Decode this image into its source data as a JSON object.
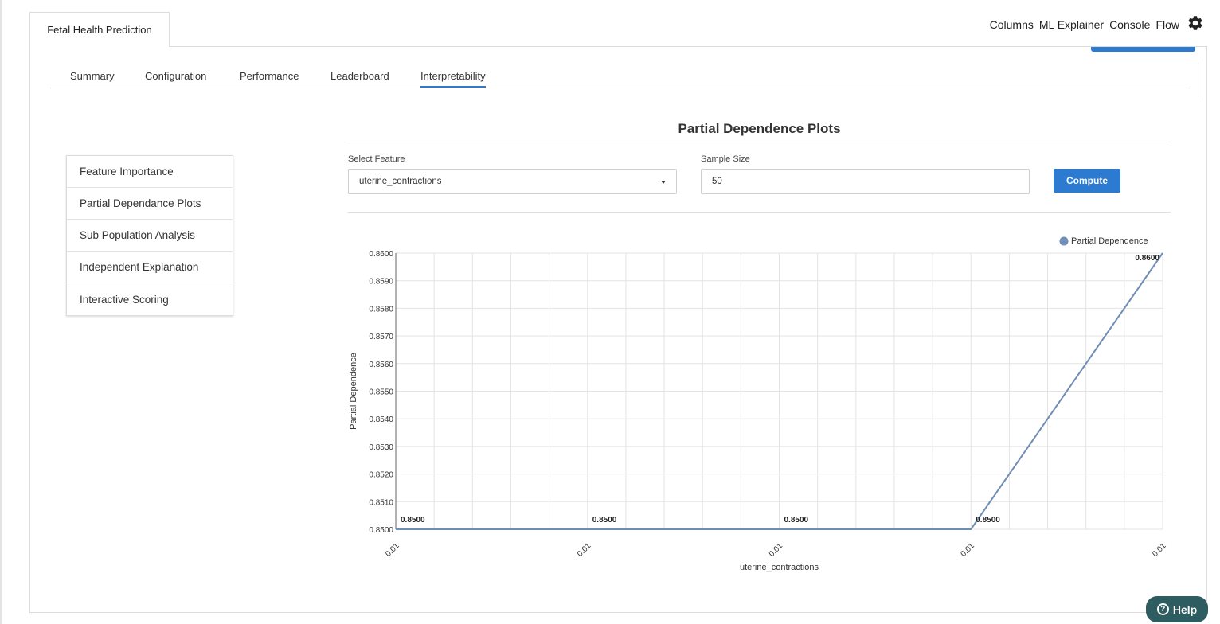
{
  "app": {
    "tab_title": "Fetal Health Prediction"
  },
  "top_nav": {
    "items": [
      "Columns",
      "ML Explainer",
      "Console",
      "Flow"
    ],
    "gear_icon": "gear-icon"
  },
  "tabs": [
    {
      "label": "Summary",
      "active": false
    },
    {
      "label": "Configuration",
      "active": false
    },
    {
      "label": "Performance",
      "active": false
    },
    {
      "label": "Leaderboard",
      "active": false
    },
    {
      "label": "Interpretability",
      "active": true
    }
  ],
  "sidebar": {
    "items": [
      {
        "label": "Feature Importance"
      },
      {
        "label": "Partial Dependance Plots"
      },
      {
        "label": "Sub Population Analysis"
      },
      {
        "label": "Independent Explanation"
      },
      {
        "label": "Interactive Scoring"
      }
    ]
  },
  "panel": {
    "title": "Partial Dependence Plots",
    "select_feature_label": "Select Feature",
    "select_feature_value": "uterine_contractions",
    "sample_size_label": "Sample Size",
    "sample_size_value": "50",
    "compute_label": "Compute"
  },
  "help": {
    "label": "Help",
    "icon_glyph": "?"
  },
  "colors": {
    "accent": "#2d7bd0",
    "line": "#6f8db5",
    "help_bg": "#2e5d61"
  },
  "chart_data": {
    "type": "line",
    "xlabel": "uterine_contractions",
    "ylabel": "Partial Dependence",
    "legend": {
      "entries": [
        "Partial Dependence"
      ],
      "position": "top-right"
    },
    "grid": true,
    "ylim": [
      0.85,
      0.86
    ],
    "yticks": [
      "0.8500",
      "0.8510",
      "0.8520",
      "0.8530",
      "0.8540",
      "0.8550",
      "0.8560",
      "0.8570",
      "0.8580",
      "0.8590",
      "0.8600"
    ],
    "x_tick_labels": [
      "0.01",
      "0.01",
      "0.01",
      "0.01",
      "0.01"
    ],
    "series": [
      {
        "name": "Partial Dependence",
        "points": [
          {
            "x": 0,
            "y": 0.85,
            "label": "0.8500"
          },
          {
            "x": 0.25,
            "y": 0.85,
            "label": "0.8500"
          },
          {
            "x": 0.5,
            "y": 0.85,
            "label": "0.8500"
          },
          {
            "x": 0.75,
            "y": 0.85,
            "label": "0.8500"
          },
          {
            "x": 1,
            "y": 0.86,
            "label": "0.8600"
          }
        ]
      }
    ]
  }
}
